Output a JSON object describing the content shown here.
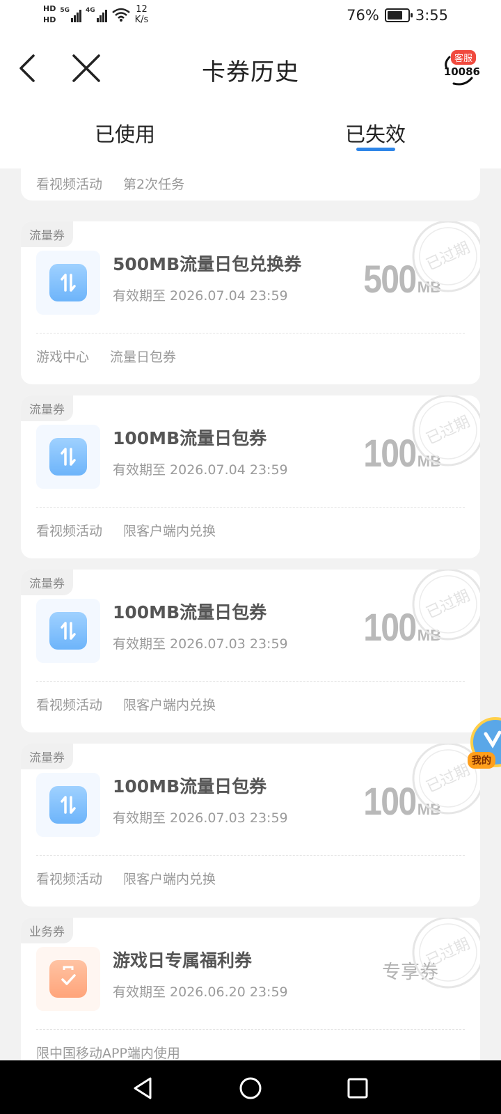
{
  "status_bar": {
    "hd1": "HD",
    "hd2": "HD",
    "net1": "5G",
    "net2": "4G",
    "speed_value": "12",
    "speed_unit": "K/s",
    "battery": "76%",
    "battery_level": 0.76,
    "time": "3:55"
  },
  "header": {
    "title": "卡券历史",
    "service_badge": "客服",
    "service_number": "10086"
  },
  "tabs": [
    {
      "label": "已使用",
      "active": false
    },
    {
      "label": "已失效",
      "active": true
    }
  ],
  "partial_card": {
    "tags": [
      "看视频活动",
      "第2次任务"
    ]
  },
  "coupons": [
    {
      "type": "流量券",
      "title": "500MB流量日包兑换券",
      "expiry": "有效期至 2026.07.04 23:59",
      "amount": "500",
      "unit": "MB",
      "tags": [
        "游戏中心",
        "流量日包券"
      ],
      "stamp": "已过期"
    },
    {
      "type": "流量券",
      "title": "100MB流量日包券",
      "expiry": "有效期至 2026.07.04 23:59",
      "amount": "100",
      "unit": "MB",
      "tags": [
        "看视频活动",
        "限客户端内兑换"
      ],
      "stamp": "已过期"
    },
    {
      "type": "流量券",
      "title": "100MB流量日包券",
      "expiry": "有效期至 2026.07.03 23:59",
      "amount": "100",
      "unit": "MB",
      "tags": [
        "看视频活动",
        "限客户端内兑换"
      ],
      "stamp": "已过期"
    },
    {
      "type": "流量券",
      "title": "100MB流量日包券",
      "expiry": "有效期至 2026.07.03 23:59",
      "amount": "100",
      "unit": "MB",
      "tags": [
        "看视频活动",
        "限客户端内兑换"
      ],
      "stamp": "已过期"
    },
    {
      "type": "业务券",
      "title": "游戏日专属福利券",
      "expiry": "有效期至 2026.06.20 23:59",
      "label": "专享券",
      "tags": [
        "限中国移动APP端内使用"
      ],
      "stamp": "已过期"
    }
  ],
  "floating": {
    "label": "我的"
  },
  "colors": {
    "accent": "#2f86e8",
    "badge_red": "#f04a3e",
    "muted_text": "#999999",
    "background": "#f2f2f2"
  }
}
